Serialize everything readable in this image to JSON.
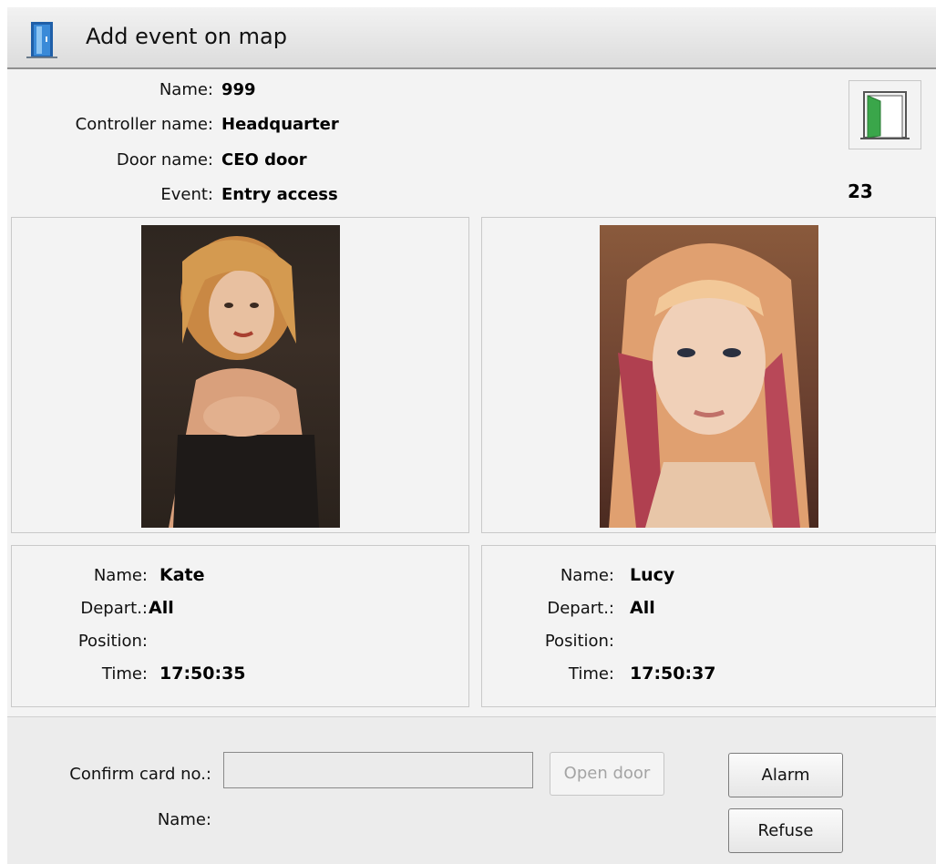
{
  "window": {
    "title": "Add event on map"
  },
  "event_info": {
    "name_label": "Name:",
    "name_value": "999",
    "controller_label": "Controller name:",
    "controller_value": "Headquarter",
    "door_label": "Door name:",
    "door_value": "CEO door",
    "event_label": "Event:",
    "event_value": "Entry access",
    "count": "23",
    "door_icon": "open-door-icon"
  },
  "persons": [
    {
      "name_label": "Name:",
      "name": "Kate",
      "depart_label": "Depart.:",
      "depart": "All",
      "position_label": "Position:",
      "position": "",
      "time_label": "Time:",
      "time": "17:50:35"
    },
    {
      "name_label": "Name:",
      "name": "Lucy",
      "depart_label": "Depart.:",
      "depart": "All",
      "position_label": "Position:",
      "position": "",
      "time_label": "Time:",
      "time": "17:50:37"
    }
  ],
  "confirm": {
    "card_label": "Confirm card no.:",
    "card_value": "",
    "card_placeholder": "",
    "name_label": "Name:",
    "open_door_label": "Open door",
    "alarm_label": "Alarm",
    "refuse_label": "Refuse"
  }
}
